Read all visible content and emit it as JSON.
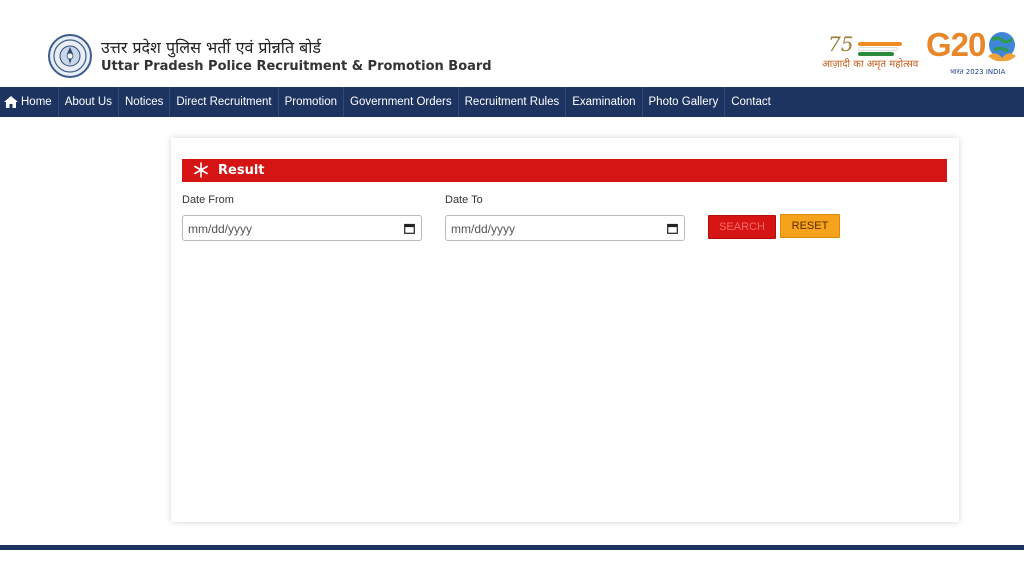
{
  "header": {
    "title_hindi": "उत्तर प्रदेश पुलिस भर्ती एवं प्रोन्नति बोर्ड",
    "title_english": "Uttar Pradesh Police Recruitment & Promotion Board",
    "azadi_number": "75",
    "azadi_text": "आज़ादी का अमृत महोत्सव",
    "g20_text": "G20",
    "g20_sub": "भारत 2023 INDIA"
  },
  "nav": {
    "items": [
      {
        "label": "Home"
      },
      {
        "label": "About Us"
      },
      {
        "label": "Notices"
      },
      {
        "label": "Direct Recruitment"
      },
      {
        "label": "Promotion"
      },
      {
        "label": "Government Orders"
      },
      {
        "label": "Recruitment Rules"
      },
      {
        "label": "Examination"
      },
      {
        "label": "Photo Gallery"
      },
      {
        "label": "Contact"
      }
    ]
  },
  "result": {
    "title": "Result",
    "date_from_label": "Date From",
    "date_from_placeholder": "mm/dd/yyyy",
    "date_to_label": "Date To",
    "date_to_placeholder": "mm/dd/yyyy",
    "search_label": "SEARCH",
    "reset_label": "RESET"
  },
  "colors": {
    "navbar": "#1d3461",
    "result_bar": "#d51414",
    "search_button": "#d51414",
    "reset_button": "#f7a21c"
  },
  "icons": {
    "home": "home-icon",
    "result": "snowflake-icon",
    "calendar": "calendar-icon"
  }
}
